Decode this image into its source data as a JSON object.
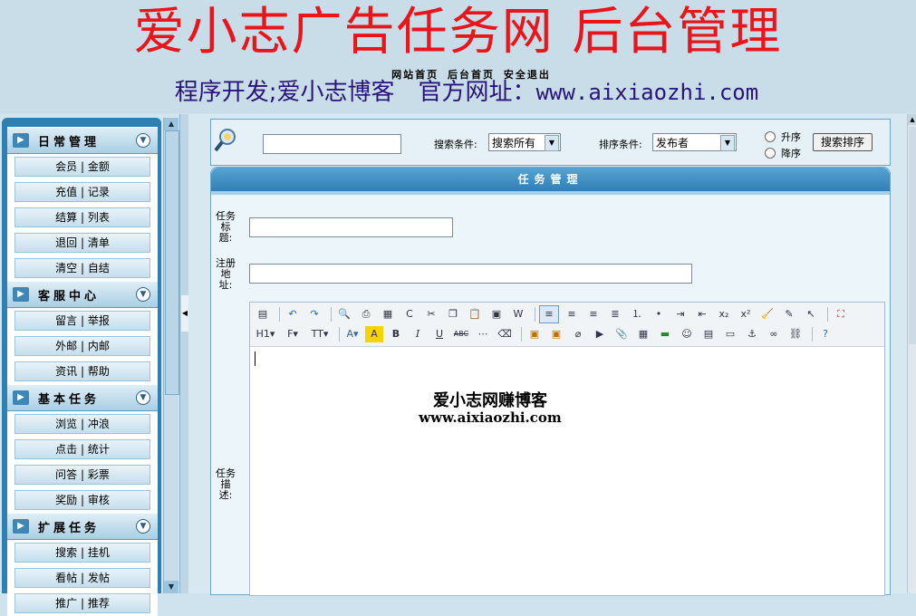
{
  "header": {
    "title": "爱小志广告任务网 后台管理",
    "links": [
      "网站首页",
      "后台首页",
      "安全退出"
    ],
    "subtitle_prefix": "程序开发;爱小志博客　官方网址：",
    "subtitle_url": "www.aixiaozhi.com"
  },
  "sidebar": {
    "sections": [
      {
        "label": "日常管理",
        "items": [
          "会员 | 金额",
          "充值 | 记录",
          "结算 | 列表",
          "退回 | 清单",
          "清空 | 自结"
        ]
      },
      {
        "label": "客服中心",
        "items": [
          "留言 | 举报",
          "外邮 | 内邮",
          "资讯 | 帮助"
        ]
      },
      {
        "label": "基本任务",
        "items": [
          "浏览 | 冲浪",
          "点击 | 统计",
          "问答 | 彩票",
          "奖励 | 审核"
        ]
      },
      {
        "label": "扩展任务",
        "items": [
          "搜索 | 挂机",
          "看帖 | 发帖",
          "推广 | 推荐"
        ]
      }
    ]
  },
  "search": {
    "input_value": "",
    "condition_label": "搜索条件:",
    "condition_value": "搜索所有",
    "sort_label": "排序条件:",
    "sort_value": "发布者",
    "asc_label": "升序",
    "desc_label": "降序",
    "button_label": "搜索排序"
  },
  "panel": {
    "title": "任务管理",
    "field_title_label": "任务标题:",
    "field_url_label": "注册地址:",
    "field_desc_label": "任务描述:",
    "title_value": "",
    "url_value": "",
    "editor_line1": "爱小志网赚博客",
    "editor_line2": "www.aixiaozhi.com",
    "toolbar_heading": "H1",
    "toolbar_font": "F",
    "toolbar_size": "TT"
  }
}
